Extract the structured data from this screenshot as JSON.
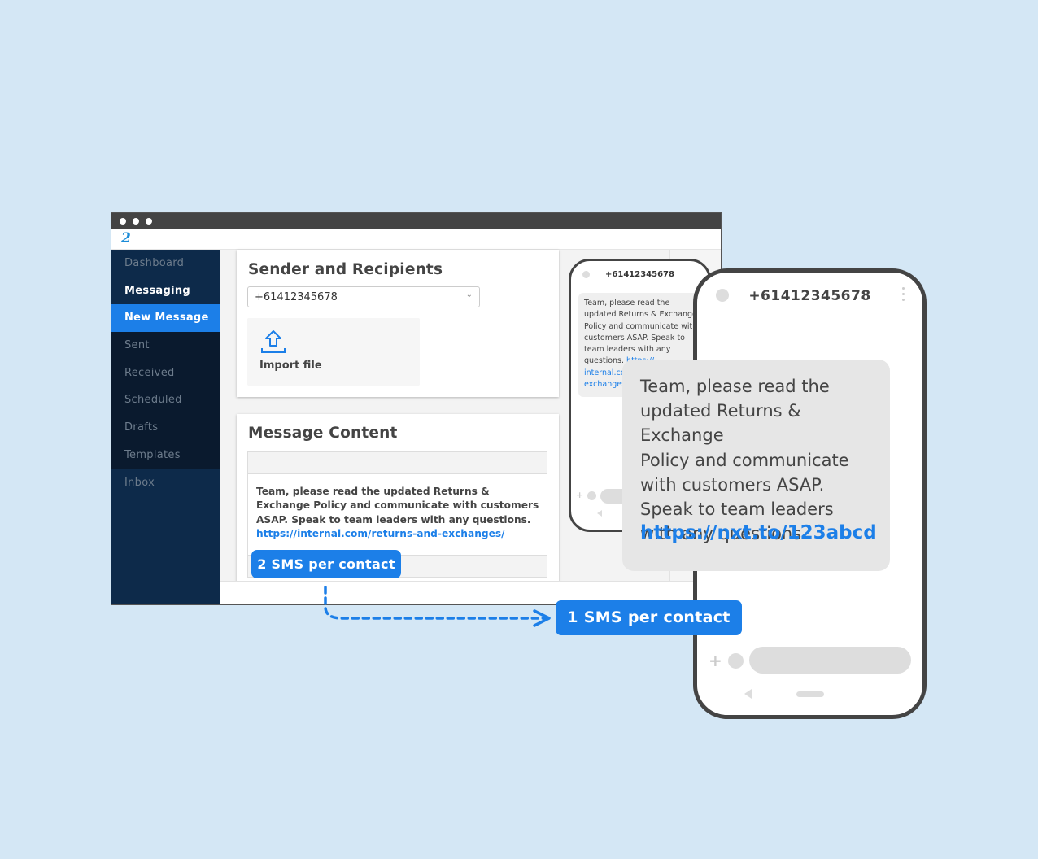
{
  "app": {
    "logo_glyph": "2"
  },
  "sidebar": {
    "items": [
      {
        "label": "Dashboard"
      },
      {
        "label": "Messaging"
      },
      {
        "label": "New Message"
      },
      {
        "label": "Sent"
      },
      {
        "label": "Received"
      },
      {
        "label": "Scheduled"
      },
      {
        "label": "Drafts"
      },
      {
        "label": "Templates"
      },
      {
        "label": "Inbox"
      }
    ]
  },
  "sender": {
    "title": "Sender and Recipients",
    "sender_value": "+61412345678",
    "import_label": "Import file"
  },
  "content": {
    "title": "Message Content",
    "message_text": "Team, please read the updated Returns & Exchange Policy and communicate with customers ASAP. Speak to team leaders with any questions.",
    "message_link": "https://internal.com/returns-and-exchanges/",
    "sms_count_badge": "2 SMS per contact"
  },
  "preview_small": {
    "number": "+61412345678",
    "text": "Team, please read the\nupdated Returns & Exchange\nPolicy and communicate with\ncustomers ASAP. Speak to\nteam leaders with any\nquestions. ",
    "link_parts": [
      "https://",
      "internal.co",
      "exchanges"
    ]
  },
  "preview_large": {
    "number": "+61412345678",
    "text": "Team, please read the\nupdated Returns & Exchange\nPolicy and communicate\nwith customers ASAP.\nSpeak to team leaders\nwith any questions.",
    "short_link": "https://nxt.to/123abcd"
  },
  "callout": {
    "result_badge": "1 SMS per contact"
  },
  "colors": {
    "accent": "#1c7fe8",
    "background": "#d4e7f5",
    "sidebar_dark": "#0a1a2e",
    "sidebar_navy": "#0d2a4a"
  }
}
